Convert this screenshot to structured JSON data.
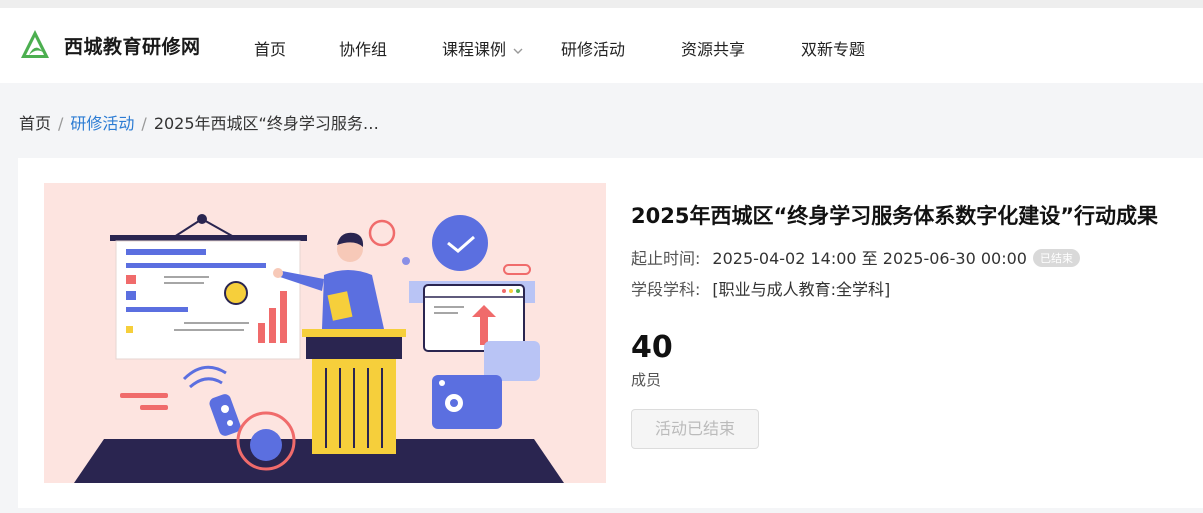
{
  "site": {
    "name": "西城教育研修网",
    "logo_icon": "leaf-logo-icon",
    "brand_color": "#4caf50"
  },
  "nav": {
    "items": [
      {
        "label": "首页"
      },
      {
        "label": "协作组"
      },
      {
        "label": "课程课例",
        "has_dropdown": true
      },
      {
        "label": "研修活动"
      },
      {
        "label": "资源共享"
      },
      {
        "label": "双新专题"
      }
    ]
  },
  "breadcrumb": {
    "home": "首页",
    "section": "研修活动",
    "current": "2025年西城区“终身学习服务…"
  },
  "activity": {
    "title": "2025年西城区“终身学习服务体系数字化建设”行动成果",
    "time_label": "起止时间:",
    "time_value": "2025-04-02 14:00 至 2025-06-30 00:00",
    "status_badge": "已结束",
    "subject_label": "学段学科:",
    "subject_value": "[职业与成人教育:全学科]",
    "member_count": "40",
    "member_label": "成员",
    "action_button": "活动已结束"
  },
  "colors": {
    "link": "#2b7bd3",
    "banner_bg": "#fde4e0",
    "illustration_blue": "#5b6fe0",
    "illustration_navy": "#2a2550",
    "illustration_yellow": "#f6cf3b",
    "illustration_red": "#f06b6b"
  }
}
